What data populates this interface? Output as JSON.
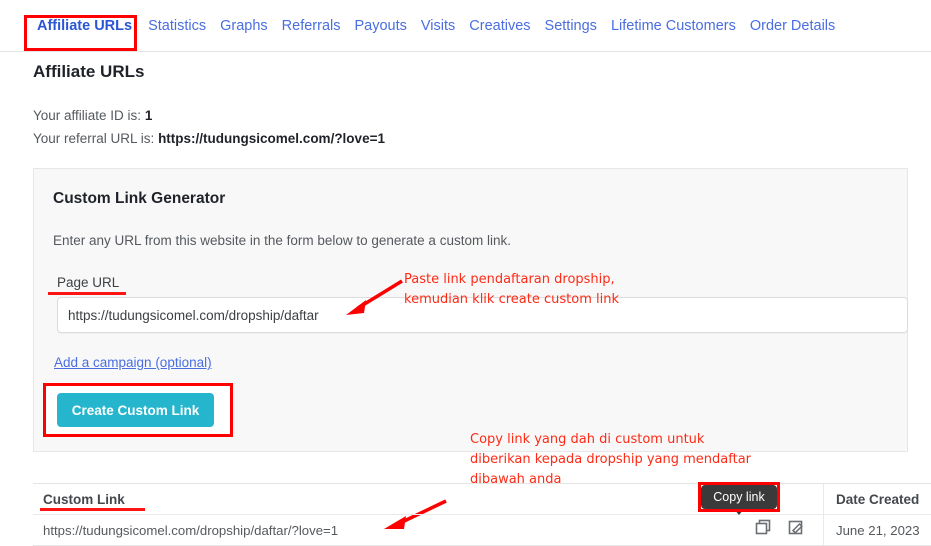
{
  "tabs": [
    {
      "label": "Affiliate URLs",
      "active": true
    },
    {
      "label": "Statistics",
      "active": false
    },
    {
      "label": "Graphs",
      "active": false
    },
    {
      "label": "Referrals",
      "active": false
    },
    {
      "label": "Payouts",
      "active": false
    },
    {
      "label": "Visits",
      "active": false
    },
    {
      "label": "Creatives",
      "active": false
    },
    {
      "label": "Settings",
      "active": false
    },
    {
      "label": "Lifetime Customers",
      "active": false
    },
    {
      "label": "Order Details",
      "active": false
    }
  ],
  "page": {
    "title": "Affiliate URLs",
    "affiliate_id_label": "Your affiliate ID is:",
    "affiliate_id_value": "1",
    "referral_url_label": "Your referral URL is:",
    "referral_url_value": "https://tudungsicomel.com/?love=1"
  },
  "generator": {
    "title": "Custom Link Generator",
    "description": "Enter any URL from this website in the form below to generate a custom link.",
    "field_label": "Page URL",
    "input_value": "https://tudungsicomel.com/dropship/daftar",
    "input_placeholder": "",
    "campaign_link": "Add a campaign (optional)",
    "create_button": "Create Custom Link"
  },
  "annotations": {
    "note_1": "Paste link pendaftaran dropship,\nkemudian klik create custom link",
    "note_2": "Copy link yang dah di custom untuk\ndiberikan kepada dropship yang mendaftar\ndibawah anda"
  },
  "tooltip": {
    "label": "Copy link"
  },
  "table": {
    "headers": {
      "custom_link": "Custom Link",
      "date_created": "Date Created"
    },
    "rows": [
      {
        "link": "https://tudungsicomel.com/dropship/daftar/?love=1",
        "date": "June 21, 2023",
        "copy_icon": "copy-icon",
        "edit_icon": "edit-icon"
      }
    ]
  },
  "colors": {
    "accent_teal": "#25b5cc",
    "tab_blue": "#4a6ee0",
    "annotation_red": "#ff2a15",
    "highlight_red": "#ff0000",
    "panel_bg": "#f8f8f8"
  }
}
